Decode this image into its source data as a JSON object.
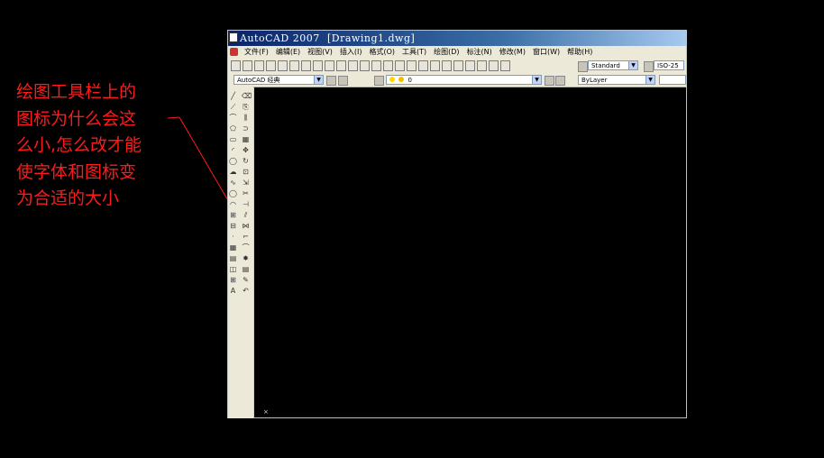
{
  "annotation": {
    "lines": [
      "绘图工具栏上的",
      "图标为什么会这",
      "么小,怎么改才能",
      "使字体和图标变",
      "为合适的大小"
    ],
    "color": "#ff1a1a"
  },
  "window": {
    "app_title": "AutoCAD 2007",
    "doc_title": "[Drawing1.dwg]"
  },
  "menu": {
    "items": [
      "文件(F)",
      "编辑(E)",
      "视图(V)",
      "插入(I)",
      "格式(O)",
      "工具(T)",
      "绘图(D)",
      "标注(N)",
      "修改(M)",
      "窗口(W)",
      "帮助(H)"
    ]
  },
  "toolbar1": {
    "text_style": "Standard",
    "dim_style": "ISO-25"
  },
  "toolbar2": {
    "workspace": "AutoCAD 经典",
    "layer": "0",
    "color": "ByLayer"
  },
  "draw_tools": [
    "line-icon",
    "xline-icon",
    "polyline-icon",
    "polygon-icon",
    "rectangle-icon",
    "arc-icon",
    "circle-icon",
    "revcloud-icon",
    "spline-icon",
    "ellipse-icon",
    "ellipse-arc-icon",
    "insert-block-icon",
    "make-block-icon",
    "point-icon",
    "hatch-icon",
    "gradient-icon",
    "region-icon",
    "table-icon",
    "mtext-icon"
  ],
  "modify_tools": [
    "erase-icon",
    "copy-icon",
    "mirror-icon",
    "offset-icon",
    "array-icon",
    "move-icon",
    "rotate-icon",
    "scale-icon",
    "stretch-icon",
    "trim-icon",
    "extend-icon",
    "break-icon",
    "join-icon",
    "chamfer-icon",
    "fillet-icon",
    "explode-icon",
    "properties-icon",
    "match-icon",
    "undo-icon"
  ]
}
